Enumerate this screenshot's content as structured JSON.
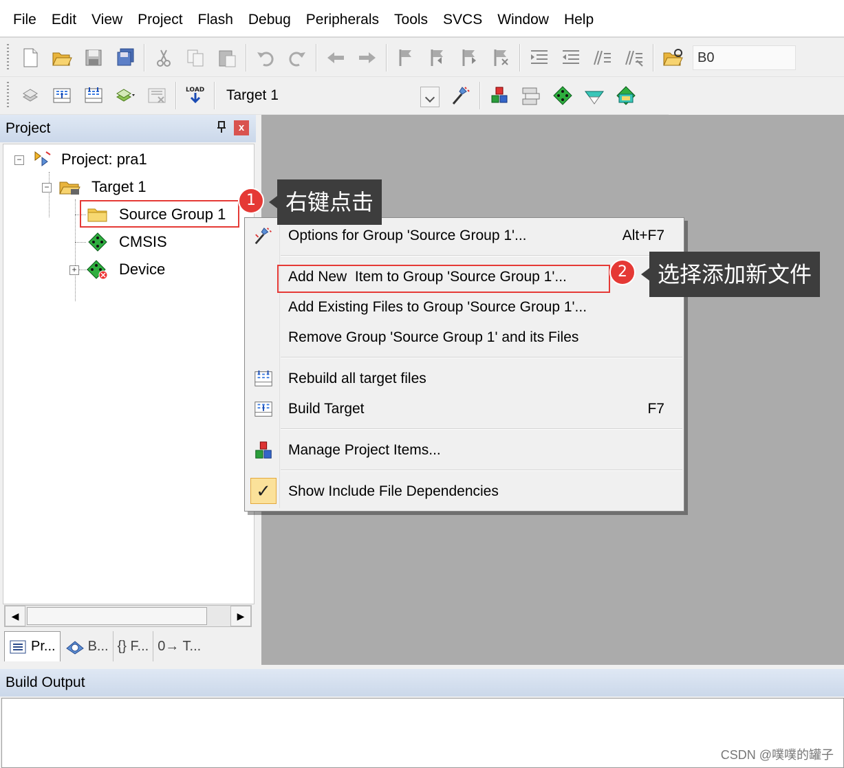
{
  "menubar": [
    "File",
    "Edit",
    "View",
    "Project",
    "Flash",
    "Debug",
    "Peripherals",
    "Tools",
    "SVCS",
    "Window",
    "Help"
  ],
  "toolbar1": {
    "icons": [
      "new-file-icon",
      "open-file-icon",
      "save-icon",
      "save-all-icon",
      "cut-icon",
      "copy-icon",
      "paste-icon",
      "undo-icon",
      "redo-icon",
      "back-icon",
      "forward-icon",
      "bookmark-icon",
      "prev-bookmark-icon",
      "next-bookmark-icon",
      "clear-bookmarks-icon",
      "indent-icon",
      "unindent-icon",
      "comment-icon",
      "uncomment-icon",
      "find-in-files-icon"
    ],
    "find_value": "B0"
  },
  "toolbar2": {
    "icons": [
      "translate-icon",
      "build-icon",
      "rebuild-icon",
      "batch-build-icon",
      "stop-build-icon",
      "load-icon"
    ],
    "load_label": "LOAD",
    "target": "Target 1",
    "icons_after": [
      "target-options-icon",
      "manage-project-items-icon",
      "select-packs-icon",
      "manage-run-time-icon",
      "pack-installer-icon",
      "software-packs-icon"
    ]
  },
  "project_panel": {
    "title": "Project",
    "pin_glyph": "ᥱ",
    "close_glyph": "x",
    "tree": {
      "root": "Project: pra1",
      "target": "Target 1",
      "children": [
        "Source Group 1",
        "CMSIS",
        "Device"
      ]
    },
    "tabs": [
      "Pr...",
      "B...",
      "{} F...",
      "0→ T..."
    ]
  },
  "context_menu": {
    "items": [
      {
        "label": "Options for Group 'Source Group 1'...",
        "shortcut": "Alt+F7"
      },
      {
        "label": "Add New  Item to Group 'Source Group 1'...",
        "shortcut": ""
      },
      {
        "label": "Add Existing Files to Group 'Source Group 1'...",
        "shortcut": ""
      },
      {
        "label": "Remove Group 'Source Group 1' and its Files",
        "shortcut": ""
      },
      {
        "label": "Rebuild all target files",
        "shortcut": ""
      },
      {
        "label": "Build Target",
        "shortcut": "F7"
      },
      {
        "label": "Manage Project Items...",
        "shortcut": ""
      },
      {
        "label": "Show Include File Dependencies",
        "shortcut": ""
      }
    ],
    "check_glyph": "✓"
  },
  "annotations": [
    {
      "number": "1",
      "text": "右键点击"
    },
    {
      "number": "2",
      "text": "选择添加新文件"
    }
  ],
  "build_output": {
    "title": "Build Output"
  },
  "watermark": "CSDN @噗噗的罐子"
}
